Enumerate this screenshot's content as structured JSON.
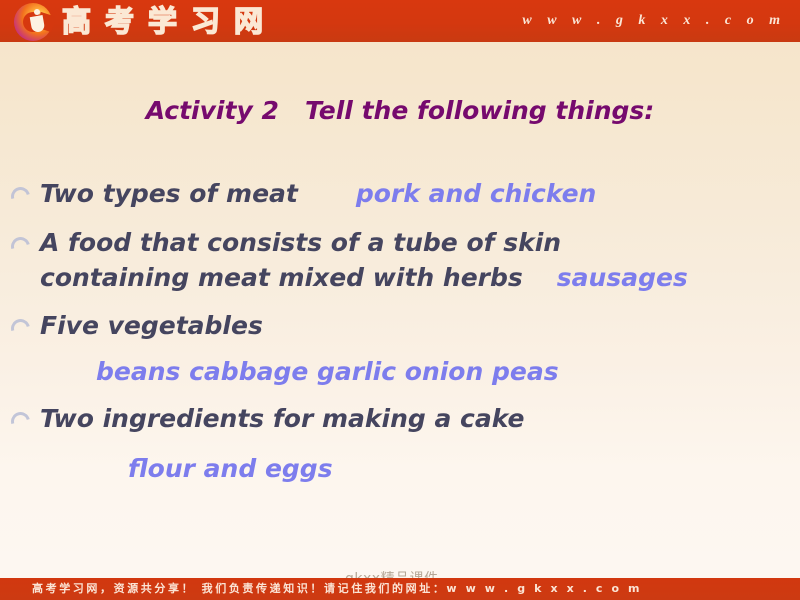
{
  "header": {
    "brand_cn": "高考学习网",
    "url": "w w w . g k x x . c o m",
    "logo_icon": "swirl-logo-icon",
    "bg_color": "#d4380f"
  },
  "slide": {
    "title": "Activity 2   Tell the following things:",
    "title_color": "#760a6e",
    "question_color": "#45455f",
    "answer_color": "#7d7ded",
    "background_top": "#f6e4c9",
    "background_bottom": "#fdf7f1",
    "bullet_icon": "arc-bullet-icon"
  },
  "items": [
    {
      "id": "meat",
      "question_lines": [
        "Two types of meat"
      ],
      "answer": "pork and chicken",
      "answer_inline": true
    },
    {
      "id": "sausages",
      "question_lines": [
        "A food that consists of a tube of skin",
        "containing meat mixed with herbs"
      ],
      "answer": "sausages",
      "answer_inline": true
    },
    {
      "id": "vegetables",
      "question_lines": [
        "Five vegetables"
      ],
      "answer": "beans cabbage garlic onion peas",
      "answer_inline": false
    },
    {
      "id": "cake",
      "question_lines": [
        "Two ingredients for making a cake"
      ],
      "answer": "flour and eggs",
      "answer_inline": false
    }
  ],
  "watermark": {
    "text": "gkxx精品课件"
  },
  "footer": {
    "text": "高考学习网，资源共分享！  我们负责传递知识！请记住我们的网址：w w w . g k x x . c o m",
    "bg_color": "#d2380f"
  }
}
